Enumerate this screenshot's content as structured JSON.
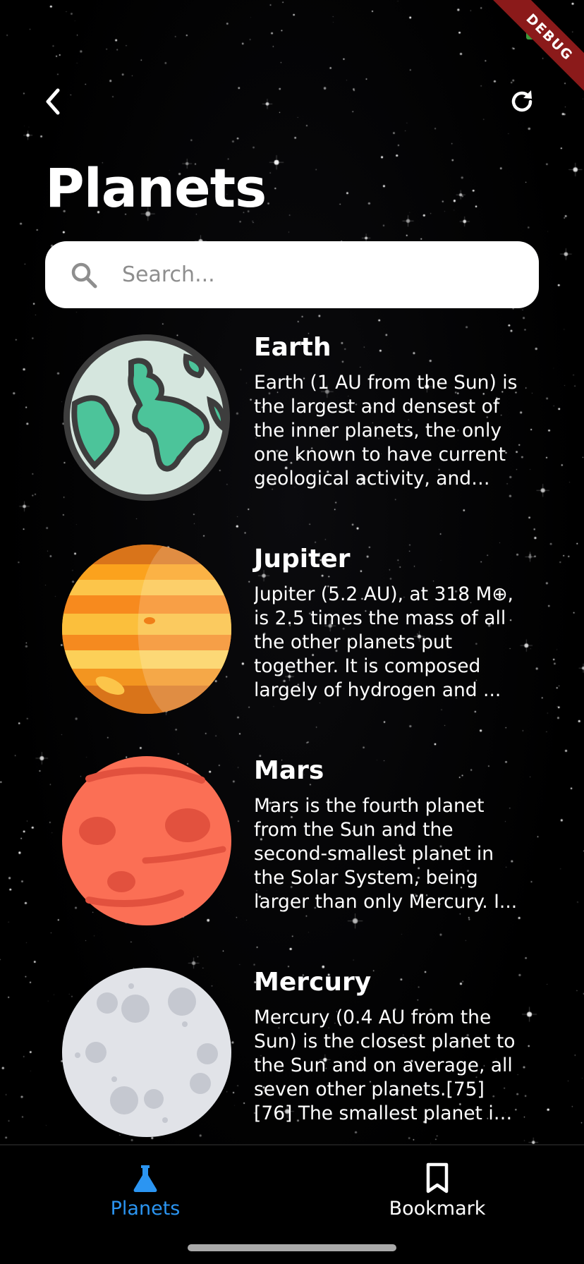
{
  "app": {
    "title": "Planets",
    "debug_badge": "DEBUG"
  },
  "search": {
    "placeholder": "Search...",
    "value": ""
  },
  "icons": {
    "back": "chevron-left-icon",
    "refresh": "refresh-icon",
    "search": "search-icon"
  },
  "planets": [
    {
      "name": "Earth",
      "description": "Earth (1 AU from the Sun) is the largest and densest of the inner planets, the only one known to have current geological activity, and the...",
      "icon": "earth-icon"
    },
    {
      "name": "Jupiter",
      "description": "Jupiter (5.2 AU), at 318 M⊕, is 2.5 times the mass of all the other planets put together. It is composed largely of hydrogen and ...",
      "icon": "jupiter-icon"
    },
    {
      "name": "Mars",
      "description": "Mars is the fourth planet from the Sun and the second-smallest planet in the Solar System, being larger than only Mercury. I...",
      "icon": "mars-icon"
    },
    {
      "name": "Mercury",
      "description": "Mercury (0.4 AU from the Sun) is the closest planet to the Sun and on average, all seven other planets.[75][76] The smallest planet in the ...",
      "icon": "mercury-icon"
    }
  ],
  "bottom_nav": {
    "items": [
      {
        "label": "Planets",
        "icon": "flask-icon",
        "active": true
      },
      {
        "label": "Bookmark",
        "icon": "bookmark-icon",
        "active": false
      }
    ]
  },
  "colors": {
    "accent": "#2b95f2",
    "background": "#000000",
    "search_background": "#ffffff"
  }
}
